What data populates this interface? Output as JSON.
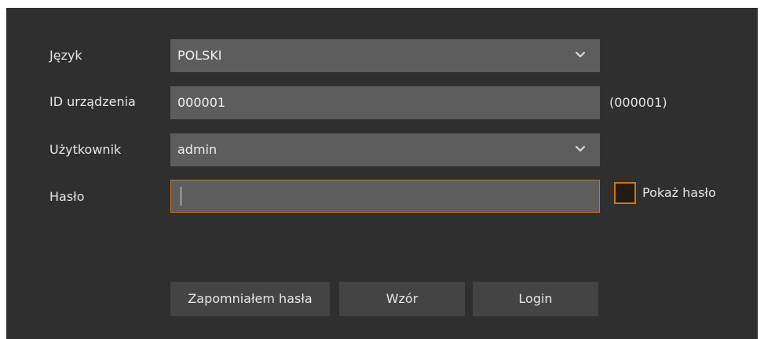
{
  "form": {
    "language": {
      "label": "Język",
      "value": "POLSKI"
    },
    "device_id": {
      "label": "ID urządzenia",
      "value": "000001",
      "hint": "(000001)"
    },
    "user": {
      "label": "Użytkownik",
      "value": "admin"
    },
    "password": {
      "label": "Hasło",
      "value": "",
      "show_password_label": "Pokaż hasło",
      "show_password_checked": false
    }
  },
  "buttons": {
    "forgot_password": "Zapomniałem hasła",
    "pattern": "Wzór",
    "login": "Login"
  },
  "colors": {
    "background": "#2f2f2f",
    "field": "#5d5d5d",
    "button": "#444444",
    "accent": "#c8781e",
    "text": "#e6e6e6"
  },
  "icons": {
    "dropdown": "chevron-down-icon"
  }
}
